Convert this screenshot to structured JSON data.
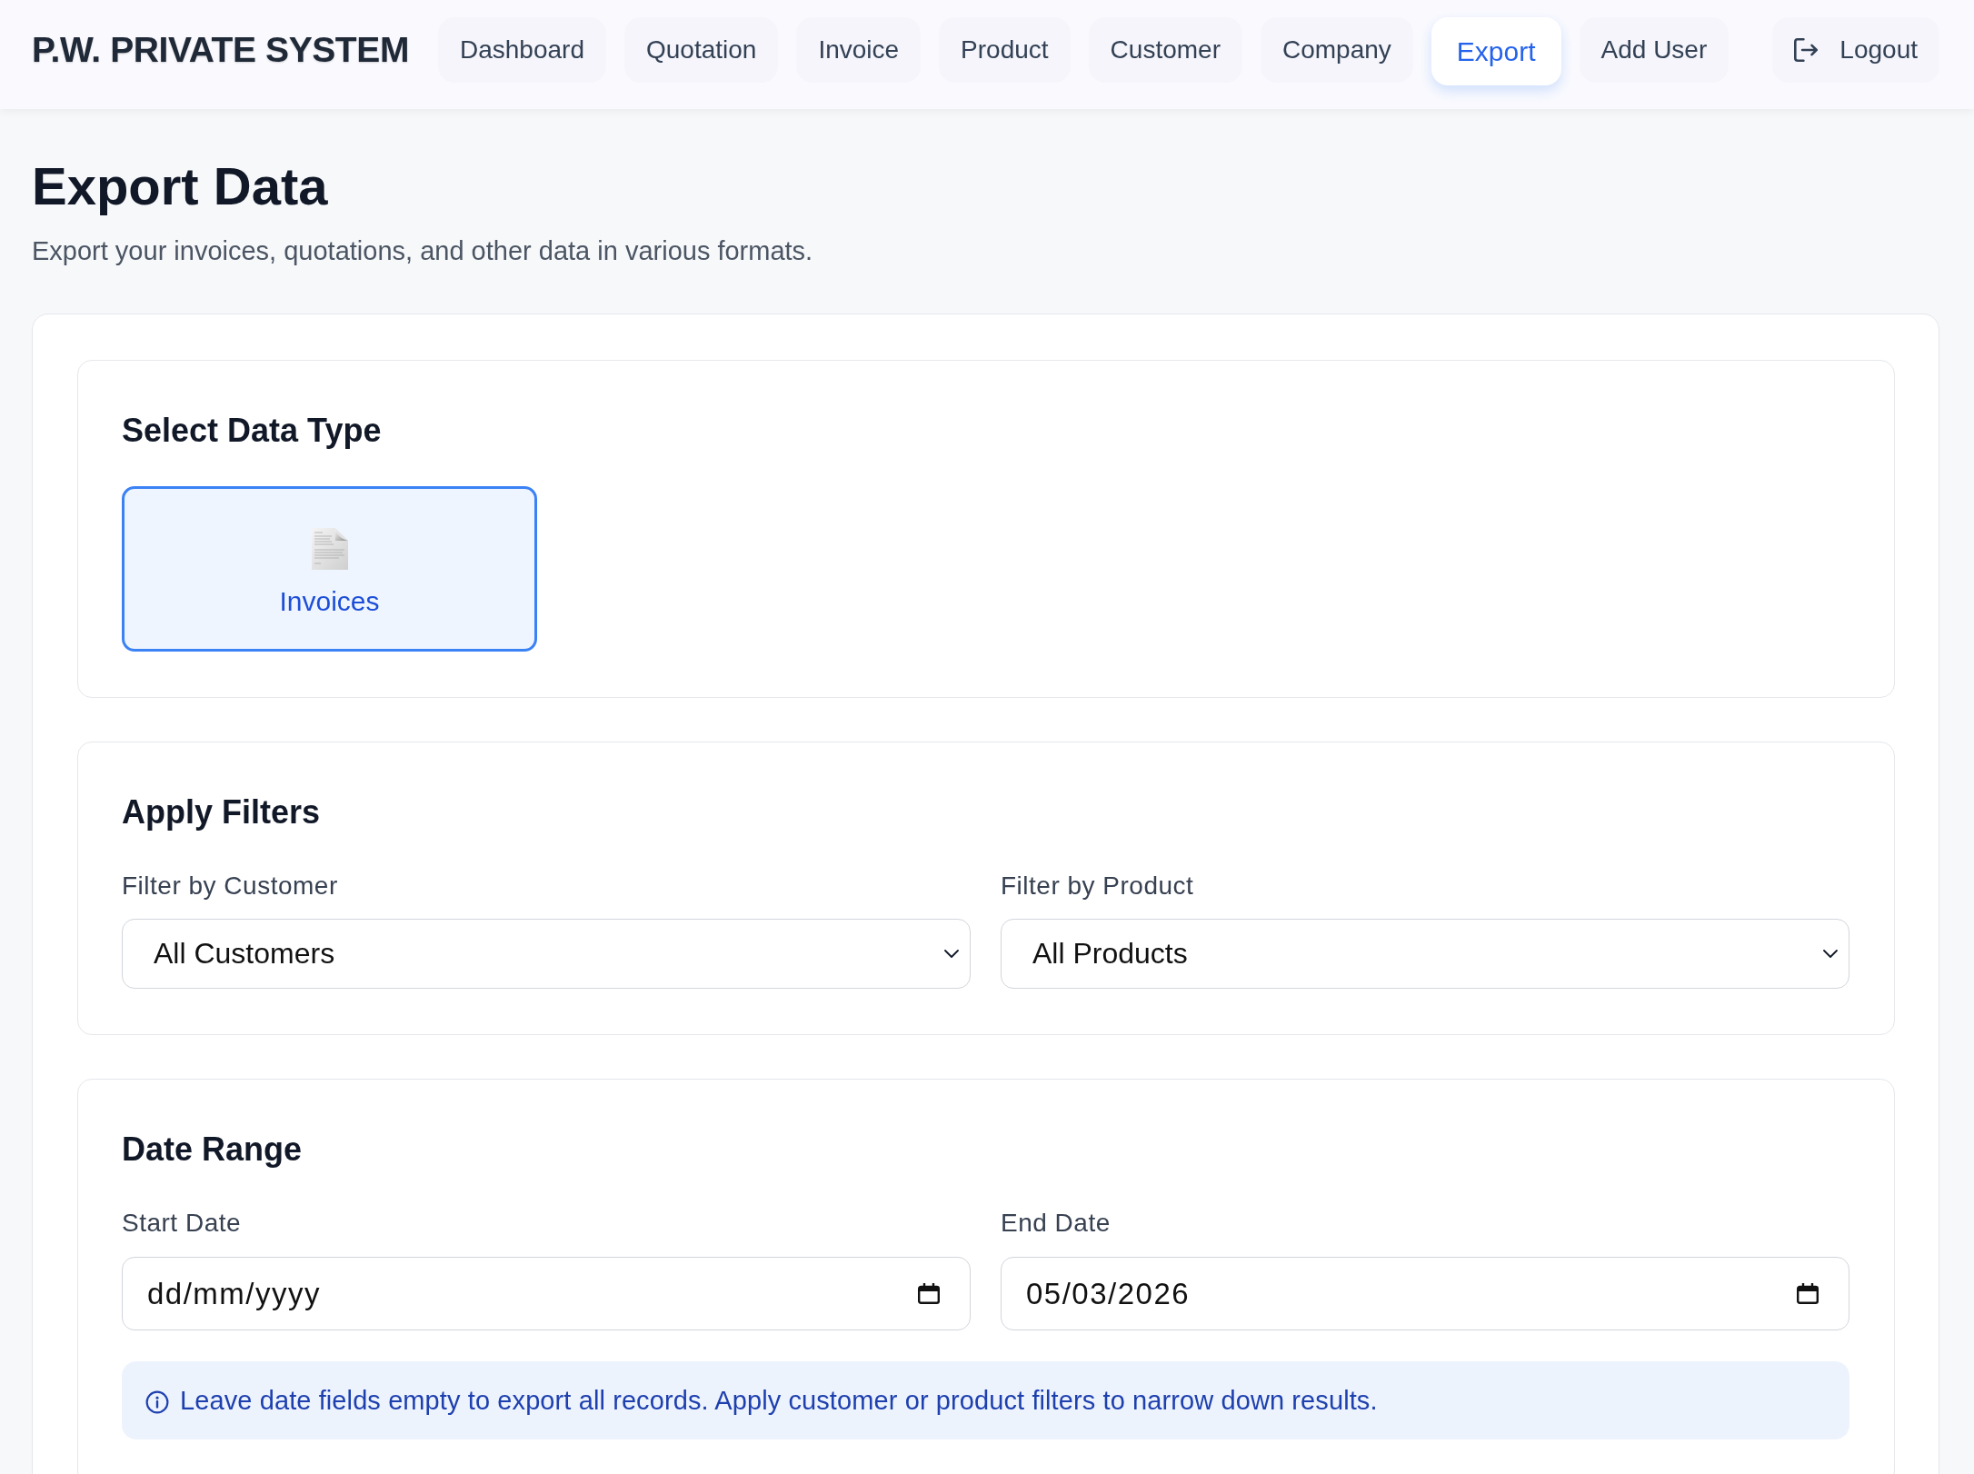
{
  "app": {
    "title": "P.W. PRIVATE SYSTEM"
  },
  "nav": [
    {
      "label": "Dashboard",
      "selected": false
    },
    {
      "label": "Quotation",
      "selected": false
    },
    {
      "label": "Invoice",
      "selected": false
    },
    {
      "label": "Product",
      "selected": false
    },
    {
      "label": "Customer",
      "selected": false
    },
    {
      "label": "Company",
      "selected": false
    },
    {
      "label": "Export",
      "selected": true
    },
    {
      "label": "Add User",
      "selected": false
    }
  ],
  "logout": {
    "label": "Logout"
  },
  "page": {
    "title": "Export Data",
    "subtitle": "Export your invoices, quotations, and other data in various formats."
  },
  "sections": [
    {
      "kind": "types",
      "title": "Select Data Type",
      "types": [
        {
          "label": "Invoices",
          "selected": true
        }
      ]
    },
    {
      "kind": "fields",
      "title": "Apply Filters",
      "fields": [
        {
          "kind": "select",
          "label": "Filter by Customer",
          "value": "All Customers"
        },
        {
          "kind": "select",
          "label": "Filter by Product",
          "value": "All Products"
        }
      ]
    },
    {
      "kind": "fields",
      "title": "Date Range",
      "fields": [
        {
          "kind": "date",
          "label": "Start Date",
          "placeholder": "dd/mm/yyyy"
        },
        {
          "kind": "date",
          "label": "End Date",
          "value": "05/03/2026"
        }
      ],
      "note": "Leave date fields empty to export all records. Apply customer or product filters to narrow down results."
    }
  ]
}
